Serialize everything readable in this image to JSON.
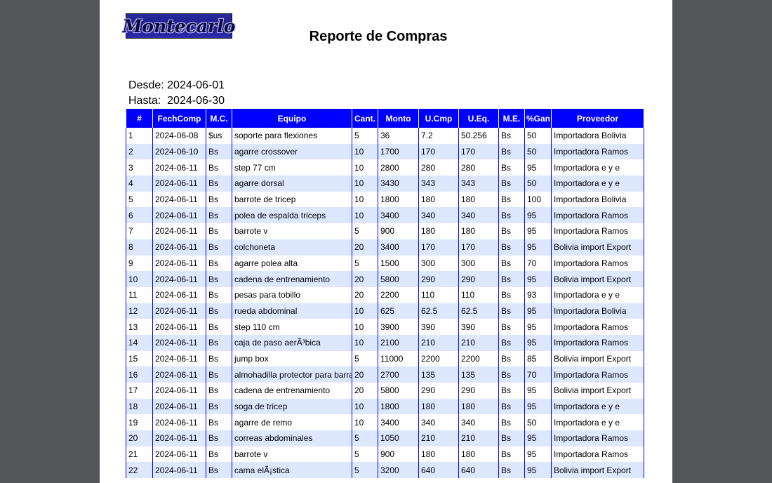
{
  "report": {
    "logo_text": "Montecarlo",
    "title": "Reporte de Compras",
    "desde_label": "Desde:",
    "desde_value": "2024-06-01",
    "hasta_label": "Hasta:",
    "hasta_value": "2024-06-30"
  },
  "table": {
    "columns": [
      "#",
      "FechComp",
      "M.C.",
      "Equipo",
      "Cant.",
      "Monto",
      "U.Cmp",
      "U.Eq.",
      "M.E.",
      "%Gan",
      "Proveedor"
    ],
    "rows": [
      [
        "1",
        "2024-06-08",
        "$us",
        "soporte para flexiones",
        "5",
        "36",
        "7.2",
        "50.256",
        "Bs",
        "50",
        "Importadora Bolivia"
      ],
      [
        "2",
        "2024-06-10",
        "Bs",
        "agarre crossover",
        "10",
        "1700",
        "170",
        "170",
        "Bs",
        "50",
        "Importadora Ramos"
      ],
      [
        "3",
        "2024-06-11",
        "Bs",
        "step 77 cm",
        "10",
        "2800",
        "280",
        "280",
        "Bs",
        "95",
        "Importadora e y e"
      ],
      [
        "4",
        "2024-06-11",
        "Bs",
        "agarre dorsal",
        "10",
        "3430",
        "343",
        "343",
        "Bs",
        "50",
        "Importadora e y e"
      ],
      [
        "5",
        "2024-06-11",
        "Bs",
        "barrote de tricep",
        "10",
        "1800",
        "180",
        "180",
        "Bs",
        "100",
        "Importadora Bolivia"
      ],
      [
        "6",
        "2024-06-11",
        "Bs",
        "polea de espalda triceps",
        "10",
        "3400",
        "340",
        "340",
        "Bs",
        "95",
        "Importadora Ramos"
      ],
      [
        "7",
        "2024-06-11",
        "Bs",
        "barrote v",
        "5",
        "900",
        "180",
        "180",
        "Bs",
        "95",
        "Importadora Ramos"
      ],
      [
        "8",
        "2024-06-11",
        "Bs",
        "colchoneta",
        "20",
        "3400",
        "170",
        "170",
        "Bs",
        "95",
        "Bolivia import Export"
      ],
      [
        "9",
        "2024-06-11",
        "Bs",
        "agarre polea alta",
        "5",
        "1500",
        "300",
        "300",
        "Bs",
        "70",
        "Importadora Ramos"
      ],
      [
        "10",
        "2024-06-11",
        "Bs",
        "cadena de entrenamiento",
        "20",
        "5800",
        "290",
        "290",
        "Bs",
        "95",
        "Bolivia import Export"
      ],
      [
        "11",
        "2024-06-11",
        "Bs",
        "pesas para tobillo",
        "20",
        "2200",
        "110",
        "110",
        "Bs",
        "93",
        "Importadora e y e"
      ],
      [
        "12",
        "2024-06-11",
        "Bs",
        "rueda abdominal",
        "10",
        "625",
        "62.5",
        "62.5",
        "Bs",
        "95",
        "Importadora Bolivia"
      ],
      [
        "13",
        "2024-06-11",
        "Bs",
        "step 110 cm",
        "10",
        "3900",
        "390",
        "390",
        "Bs",
        "95",
        "Importadora Ramos"
      ],
      [
        "14",
        "2024-06-11",
        "Bs",
        "caja de paso aerÃ³bica",
        "10",
        "2100",
        "210",
        "210",
        "Bs",
        "95",
        "Importadora Ramos"
      ],
      [
        "15",
        "2024-06-11",
        "Bs",
        "jump box",
        "5",
        "11000",
        "2200",
        "2200",
        "Bs",
        "85",
        "Bolivia import Export"
      ],
      [
        "16",
        "2024-06-11",
        "Bs",
        "almohadilla protector para barra",
        "20",
        "2700",
        "135",
        "135",
        "Bs",
        "70",
        "Importadora Ramos"
      ],
      [
        "17",
        "2024-06-11",
        "Bs",
        "cadena de entrenamiento",
        "20",
        "5800",
        "290",
        "290",
        "Bs",
        "95",
        "Bolivia import Export"
      ],
      [
        "18",
        "2024-06-11",
        "Bs",
        "soga de tricep",
        "10",
        "1800",
        "180",
        "180",
        "Bs",
        "95",
        "Importadora e y e"
      ],
      [
        "19",
        "2024-06-11",
        "Bs",
        "agarre de remo",
        "10",
        "3400",
        "340",
        "340",
        "Bs",
        "50",
        "Importadora e y e"
      ],
      [
        "20",
        "2024-06-11",
        "Bs",
        "correas abdominales",
        "5",
        "1050",
        "210",
        "210",
        "Bs",
        "95",
        "Importadora Ramos"
      ],
      [
        "21",
        "2024-06-11",
        "Bs",
        "barrote v",
        "5",
        "900",
        "180",
        "180",
        "Bs",
        "95",
        "Importadora Ramos"
      ],
      [
        "22",
        "2024-06-11",
        "Bs",
        "cama elÃ¡stica",
        "5",
        "3200",
        "640",
        "640",
        "Bs",
        "95",
        "Bolivia import Export"
      ]
    ]
  }
}
